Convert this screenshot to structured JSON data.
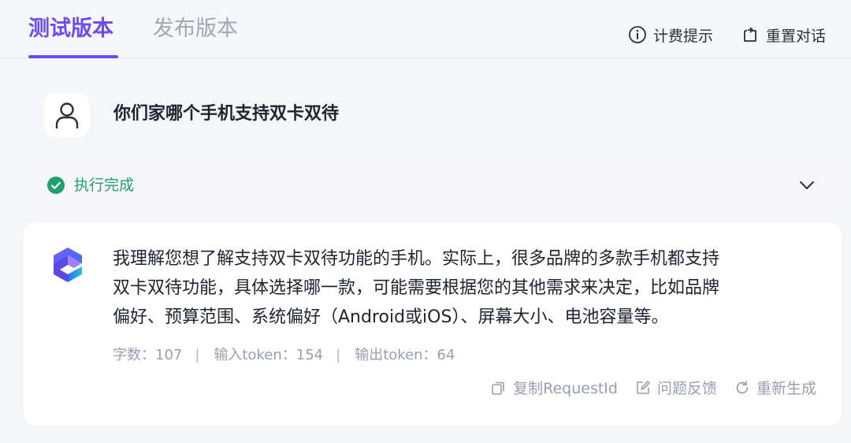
{
  "tabs": {
    "active_label": "测试版本",
    "inactive_label": "发布版本"
  },
  "top_actions": {
    "billing_label": "计费提示",
    "reset_label": "重置对话"
  },
  "user_message": {
    "text": "你们家哪个手机支持双卡双待"
  },
  "status": {
    "text": "执行完成",
    "color": "#22a06b"
  },
  "answer": {
    "line1": "我理解您想了解支持双卡双待功能的手机。实际上，很多品牌的多款手机都支持",
    "line2": "双卡双待功能，具体选择哪一款，可能需要根据您的其他需求来决定，比如品牌",
    "line3": "偏好、预算范围、系统偏好（Android或iOS）、屏幕大小、电池容量等。"
  },
  "stats": {
    "char_count": "字数：107",
    "input_tokens": "输入token：154",
    "output_tokens": "输出token：64",
    "separator": "|"
  },
  "answer_actions": {
    "copy_label": "复制RequestId",
    "feedback_label": "问题反馈",
    "regenerate_label": "重新生成"
  },
  "colors": {
    "accent": "#6b4cf6",
    "success": "#22a06b"
  }
}
